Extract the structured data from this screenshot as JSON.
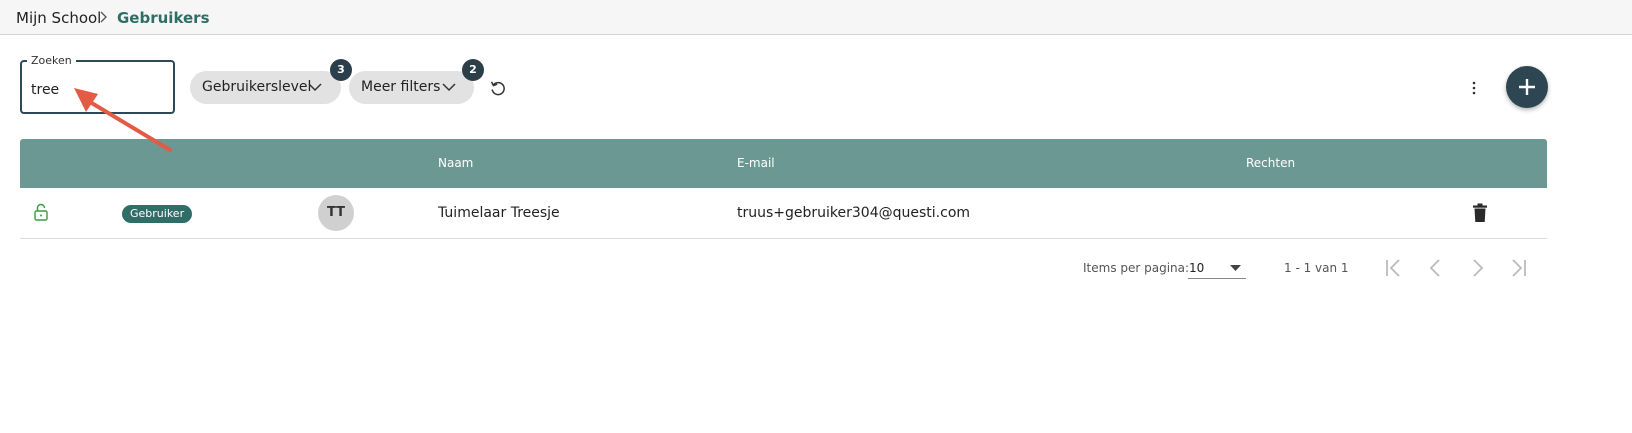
{
  "breadcrumb": {
    "home": "Mijn School",
    "current": "Gebruikers"
  },
  "search": {
    "label": "Zoeken",
    "value": "tree"
  },
  "filters": {
    "level": {
      "label": "Gebruikerslevel",
      "count": "3"
    },
    "more": {
      "label": "Meer filters",
      "count": "2"
    }
  },
  "table": {
    "headers": {
      "name": "Naam",
      "email": "E-mail",
      "rights": "Rechten"
    },
    "rows": [
      {
        "role": "Gebruiker",
        "initials": "TT",
        "name": "Tuimelaar Treesje",
        "email": "truus+gebruiker304@questi.com",
        "rights": ""
      }
    ]
  },
  "paginator": {
    "items_label": "Items per pagina:",
    "page_size": "10",
    "range": "1 - 1 van 1"
  },
  "colors": {
    "header": "#6b9892",
    "accent": "#2f6e66",
    "dark": "#2e4552",
    "annotation": "#e35b44",
    "lock": "#3a9a45"
  }
}
